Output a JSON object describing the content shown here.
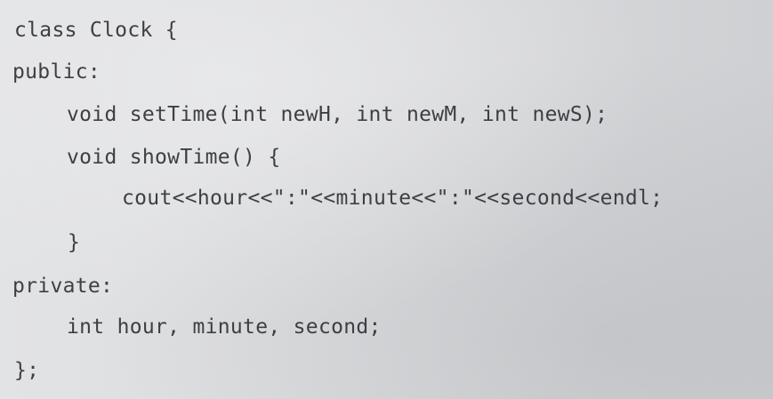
{
  "code_lines": [
    "class Clock {",
    "public:",
    "void setTime(int newH, int newM, int newS);",
    "void showTime() {",
    "cout<<hour<<\":\"<<minute<<\":\"<<second<<endl;",
    "}",
    "private:",
    "int hour, minute, second;",
    "};"
  ]
}
